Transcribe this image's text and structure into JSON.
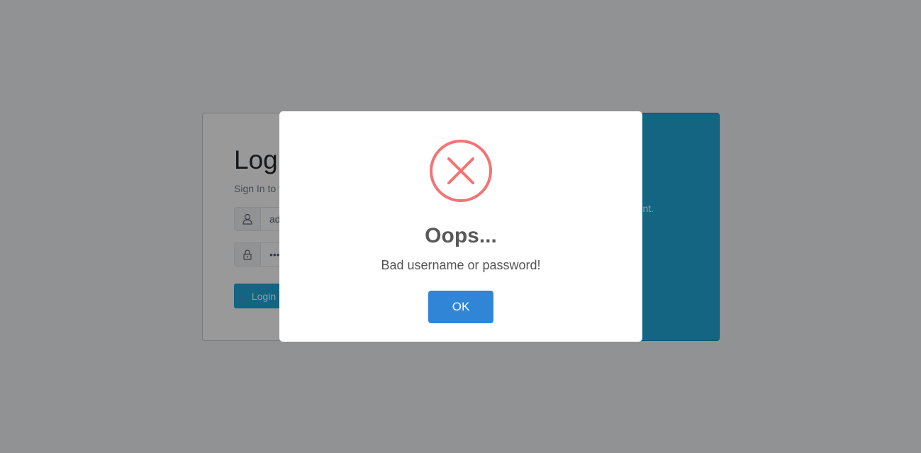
{
  "login": {
    "title": "Login",
    "subtitle": "Sign In to your account",
    "username_value": "admin",
    "password_value": "••••••••",
    "login_button": "Login"
  },
  "register": {
    "text": "Sign up to create an account."
  },
  "dialog": {
    "icon": "error-x-circle-icon",
    "title": "Oops...",
    "message": "Bad username or password!",
    "ok_button": "OK"
  },
  "colors": {
    "error_icon": "#f27474",
    "ok_button": "#3085d6",
    "register_panel": "#20a8d8"
  }
}
